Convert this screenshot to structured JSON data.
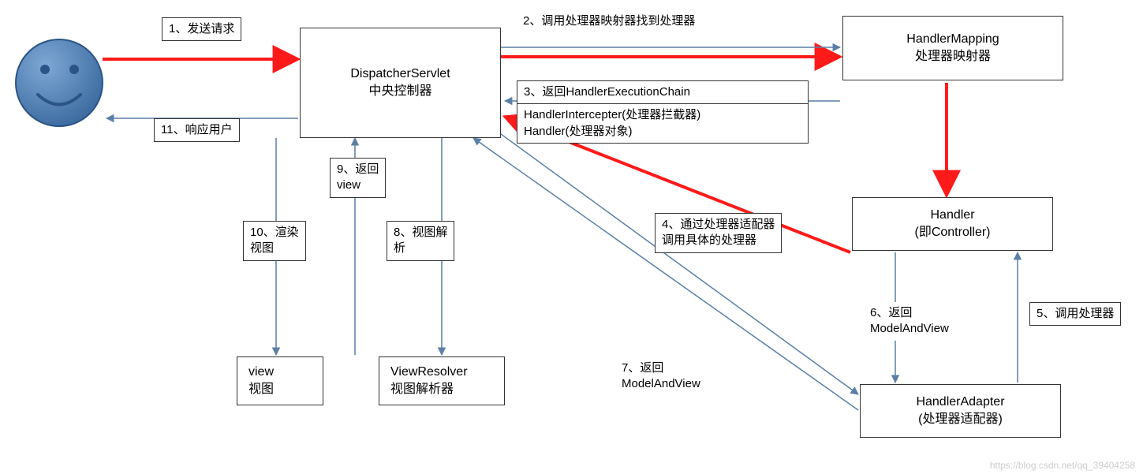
{
  "nodes": {
    "dispatcher": {
      "line1": "DispatcherServlet",
      "line2": "中央控制器"
    },
    "handlerMapping": {
      "line1": "HandlerMapping",
      "line2": "处理器映射器"
    },
    "handler": {
      "line1": "Handler",
      "line2": "(即Controller)"
    },
    "handlerAdapter": {
      "line1": "HandlerAdapter",
      "line2": "(处理器适配器)"
    },
    "viewResolver": {
      "line1": "ViewResolver",
      "line2": "视图解析器"
    },
    "view": {
      "line1": "view",
      "line2": "视图"
    }
  },
  "labels": {
    "step1": "1、发送请求",
    "step2": "2、调用处理器映射器找到处理器",
    "step3_title": "3、返回HandlerExecutionChain",
    "step3_body1": "HandlerIntercepter(处理器拦截器)",
    "step3_body2": "Handler(处理器对象)",
    "step4_l1": "4、通过处理器适配器",
    "step4_l2": "调用具体的处理器",
    "step5": "5、调用处理器",
    "step6_l1": "6、返回",
    "step6_l2": "ModelAndView",
    "step7_l1": "7、返回",
    "step7_l2": "ModelAndView",
    "step8_l1": "8、视图解",
    "step8_l2": "析",
    "step9_l1": "9、返回",
    "step9_l2": "view",
    "step10_l1": "10、渲染",
    "step10_l2": "视图",
    "step11": "11、响应用户"
  },
  "watermark": "https://blog.csdn.net/qq_39404258"
}
